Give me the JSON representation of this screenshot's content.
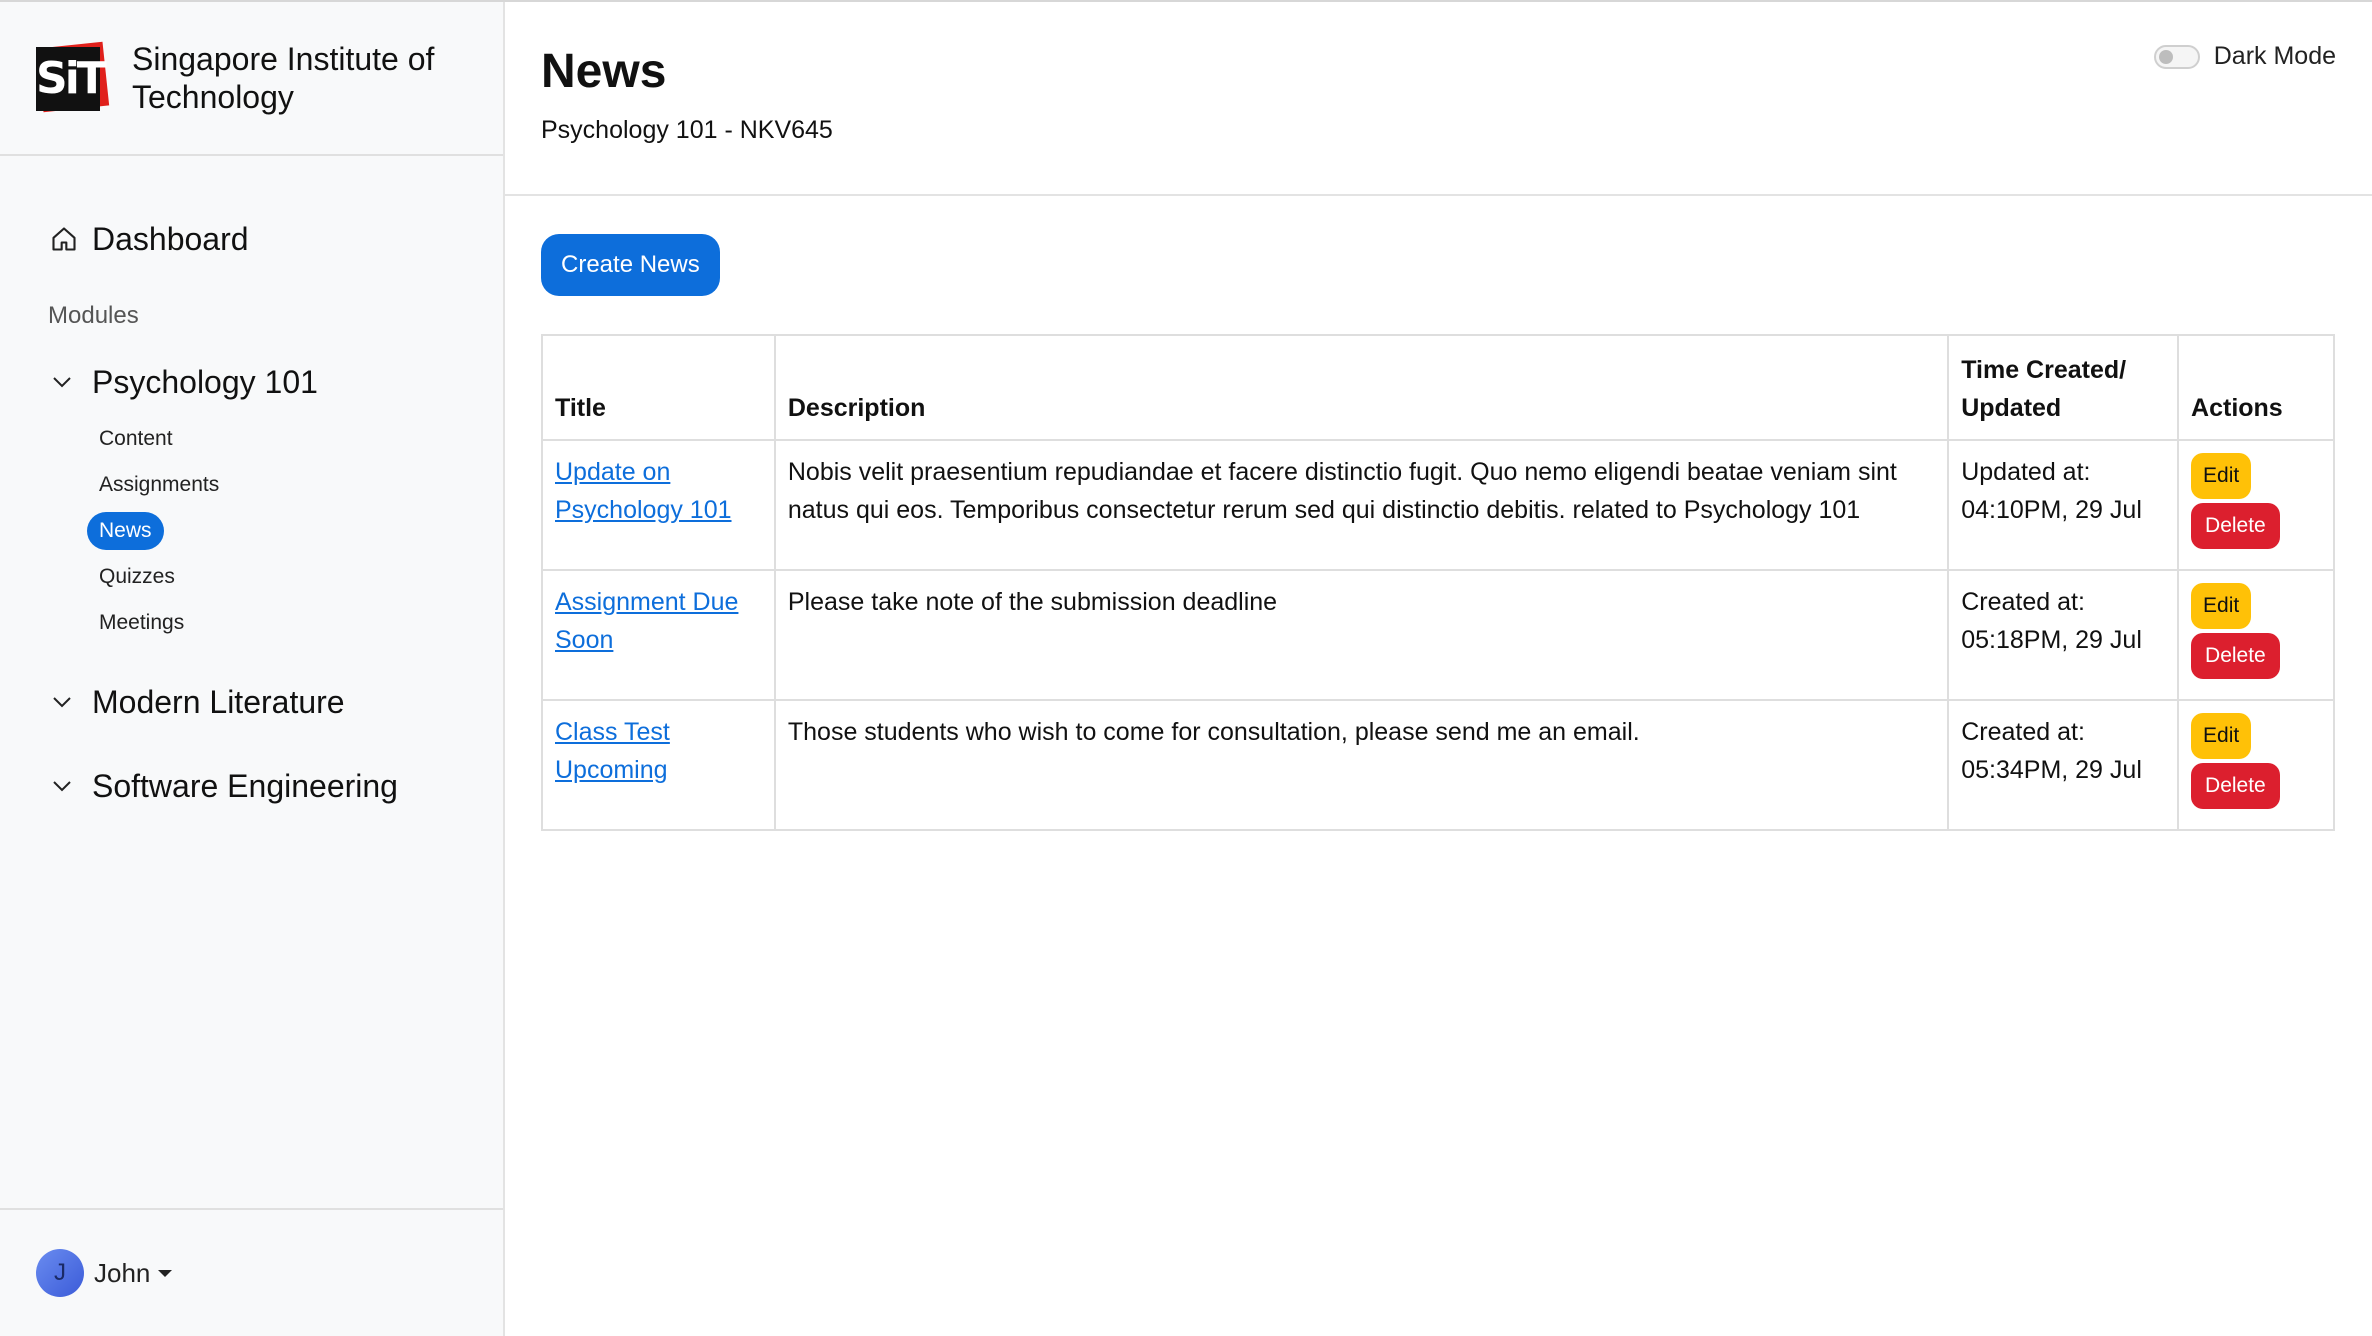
{
  "brand": {
    "logo_text": "SiT",
    "name_line1": "Singapore Institute of",
    "name_line2": "Technology"
  },
  "nav": {
    "dashboard_label": "Dashboard",
    "modules_label": "Modules",
    "modules": [
      {
        "name": "Psychology 101",
        "expanded": true,
        "items": [
          "Content",
          "Assignments",
          "News",
          "Quizzes",
          "Meetings"
        ],
        "active_item": "News"
      },
      {
        "name": "Modern Literature",
        "expanded": false
      },
      {
        "name": "Software Engineering",
        "expanded": false
      }
    ]
  },
  "user": {
    "initial": "J",
    "name": "John"
  },
  "header": {
    "title": "News",
    "subtitle": "Psychology 101 - NKV645",
    "dark_mode_label": "Dark Mode",
    "dark_mode_on": false
  },
  "actions": {
    "create_label": "Create News"
  },
  "table": {
    "headers": {
      "title": "Title",
      "description": "Description",
      "time_line1": "Time Created/",
      "time_line2": "Updated",
      "actions": "Actions"
    },
    "rows": [
      {
        "title": "Update on Psychology 101",
        "description": "Nobis velit praesentium repudiandae et facere distinctio fugit. Quo nemo eligendi beatae veniam sint natus qui eos. Temporibus consectetur rerum sed qui distinctio debitis. related to Psychology 101",
        "time_label": "Updated at:",
        "time_value": "04:10PM, 29 Jul",
        "edit_label": "Edit",
        "delete_label": "Delete"
      },
      {
        "title": "Assignment Due Soon",
        "description": "Please take note of the submission deadline",
        "time_label": "Created at:",
        "time_value": "05:18PM, 29 Jul",
        "edit_label": "Edit",
        "delete_label": "Delete"
      },
      {
        "title": "Class Test Upcoming",
        "description": "Those students who wish to come for consultation, please send me an email.",
        "time_label": "Created at:",
        "time_value": "05:34PM, 29 Jul",
        "edit_label": "Edit",
        "delete_label": "Delete"
      }
    ]
  },
  "colors": {
    "primary": "#0d6edb",
    "edit": "#ffc107",
    "delete": "#dc1f2e",
    "sidebar_bg": "#f8f9fa"
  }
}
